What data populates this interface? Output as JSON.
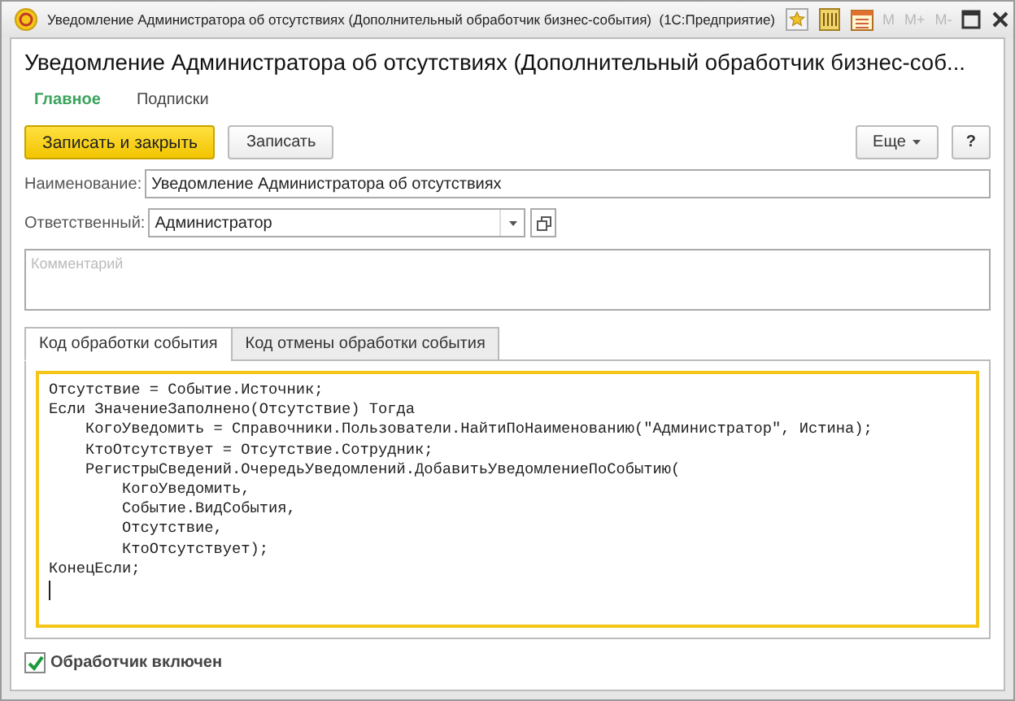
{
  "window": {
    "title": "Уведомление Администратора об отсутствиях (Дополнительный обработчик бизнес-события)  (1С:Предприятие)",
    "memory_buttons": [
      {
        "label": "M",
        "disabled": true
      },
      {
        "label": "M+",
        "disabled": true
      },
      {
        "label": "M-",
        "disabled": true
      }
    ]
  },
  "form_title": "Уведомление Администратора об отсутствиях (Дополнительный обработчик бизнес-соб...",
  "nav": [
    {
      "label": "Главное",
      "selected": true
    },
    {
      "label": "Подписки",
      "selected": false
    }
  ],
  "buttons": [
    {
      "label": "Записать и закрыть",
      "kind": "primary"
    },
    {
      "label": "Записать",
      "kind": "normal"
    }
  ],
  "more_button": "Еще",
  "help_button": "?",
  "name_field": {
    "label": "Наименование:",
    "value": "Уведомление Администратора об отсутствиях"
  },
  "owner_field": {
    "label": "Ответственный:",
    "value": "Администратор"
  },
  "comment": {
    "placeholder": "Комментарий"
  },
  "tabs": [
    {
      "label": "Код обработки события",
      "selected": true
    },
    {
      "label": "Код отмены обработки события",
      "selected": false
    }
  ],
  "code": [
    "Отсутствие = Событие.Источник;",
    "Если ЗначениеЗаполнено(Отсутствие) Тогда",
    "    КогоУведомить = Справочники.Пользователи.НайтиПоНаименованию(\"Администратор\", Истина);",
    "    КтоОтсутствует = Отсутствие.Сотрудник;",
    "    РегистрыСведений.ОчередьУведомлений.ДобавитьУведомлениеПоСобытию(",
    "        КогоУведомить,",
    "        Событие.ВидСобытия,",
    "        Отсутствие,",
    "        КтоОтсутствует);",
    "КонецЕсли;"
  ],
  "enabled_checkbox": {
    "label": "Обработчик включен",
    "checked": true
  }
}
